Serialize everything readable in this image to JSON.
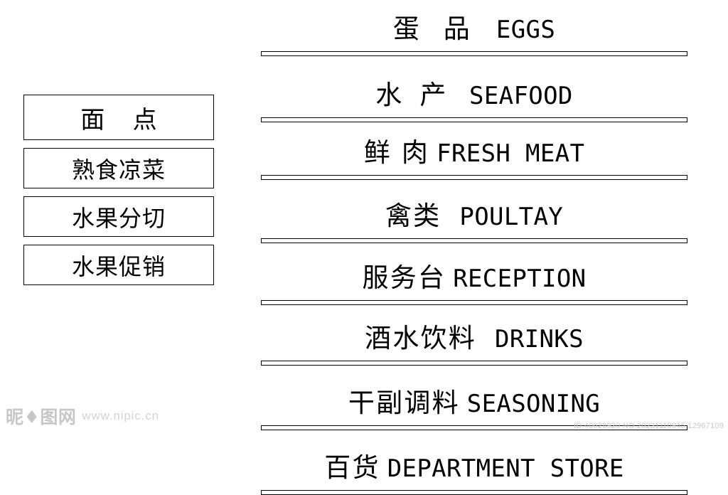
{
  "page": {
    "background_color": "#ffffff",
    "ink_color": "#000000"
  },
  "left_column": {
    "signs": [
      {
        "label": "面 点",
        "style": "wide"
      },
      {
        "label": "熟食凉菜",
        "style": "normal"
      },
      {
        "label": "水果分切",
        "style": "normal"
      },
      {
        "label": "水果促销",
        "style": "normal"
      }
    ]
  },
  "right_column": {
    "signs": [
      {
        "cn": "蛋 品",
        "en": "EGGS",
        "cn_spacing": "sp-wide",
        "gap": "gap-lg"
      },
      {
        "cn": "水 产",
        "en": "SEAFOOD",
        "cn_spacing": "sp-mid",
        "gap": "gap-lg"
      },
      {
        "cn": "鲜 肉",
        "en": "FRESH MEAT",
        "cn_spacing": "sp-sm",
        "gap": "gap-sm"
      },
      {
        "cn": "禽类",
        "en": "POULTAY",
        "cn_spacing": "sp-sm",
        "gap": "gap-lg"
      },
      {
        "cn": "服务台",
        "en": "RECEPTION",
        "cn_spacing": "sp-sm",
        "gap": "gap-sm"
      },
      {
        "cn": "酒水饮料",
        "en": "DRINKS",
        "cn_spacing": "sp-sm",
        "gap": "gap-lg"
      },
      {
        "cn": "干副调料",
        "en": "SEASONING",
        "cn_spacing": "sp-sm",
        "gap": "gap-sm"
      },
      {
        "cn": "百货",
        "en": "DEPARTMENT STORE",
        "cn_spacing": "sp-sm",
        "gap": "gap-sm"
      }
    ]
  },
  "watermarks": {
    "logo_text": "昵♦图网",
    "url_text": "www.nipic.cn",
    "id_text": "ID:40628920  NO.20231110945 12967109"
  }
}
